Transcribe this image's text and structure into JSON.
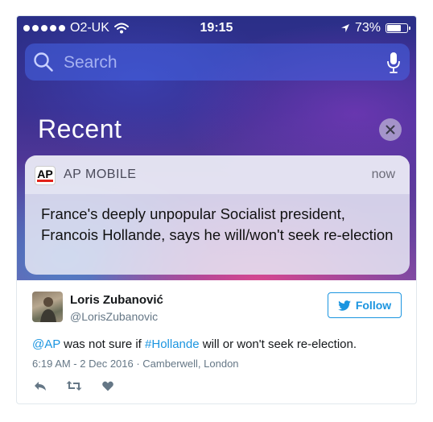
{
  "status_bar": {
    "carrier": "O2-UK",
    "time": "19:15",
    "battery": "73%",
    "battery_level": 0.73
  },
  "search": {
    "placeholder": "Search"
  },
  "section_title": "Recent",
  "notification": {
    "app_name": "AP MOBILE",
    "app_icon_text": "AP",
    "time": "now",
    "body": "France's deeply unpopular Socialist president, Francois Hollande, says he will/won't seek re-election"
  },
  "tweet": {
    "author_name": "Loris Zubanović",
    "author_handle": "@LorisZubanovic",
    "follow_label": "Follow",
    "text_mention": "@AP",
    "text_part1": " was not sure if ",
    "text_hashtag": "#Hollande",
    "text_part2": " will or won't seek re-election.",
    "meta": "6:19 AM - 2 Dec 2016 · Camberwell, London"
  },
  "colors": {
    "twitter_blue": "#1b95e0",
    "ap_red": "#e2231a"
  },
  "icons": [
    "signal-dots-icon",
    "wifi-icon",
    "location-arrow-icon",
    "battery-icon",
    "search-icon",
    "microphone-icon",
    "close-icon",
    "twitter-bird-icon",
    "reply-icon",
    "retweet-icon",
    "heart-icon"
  ]
}
